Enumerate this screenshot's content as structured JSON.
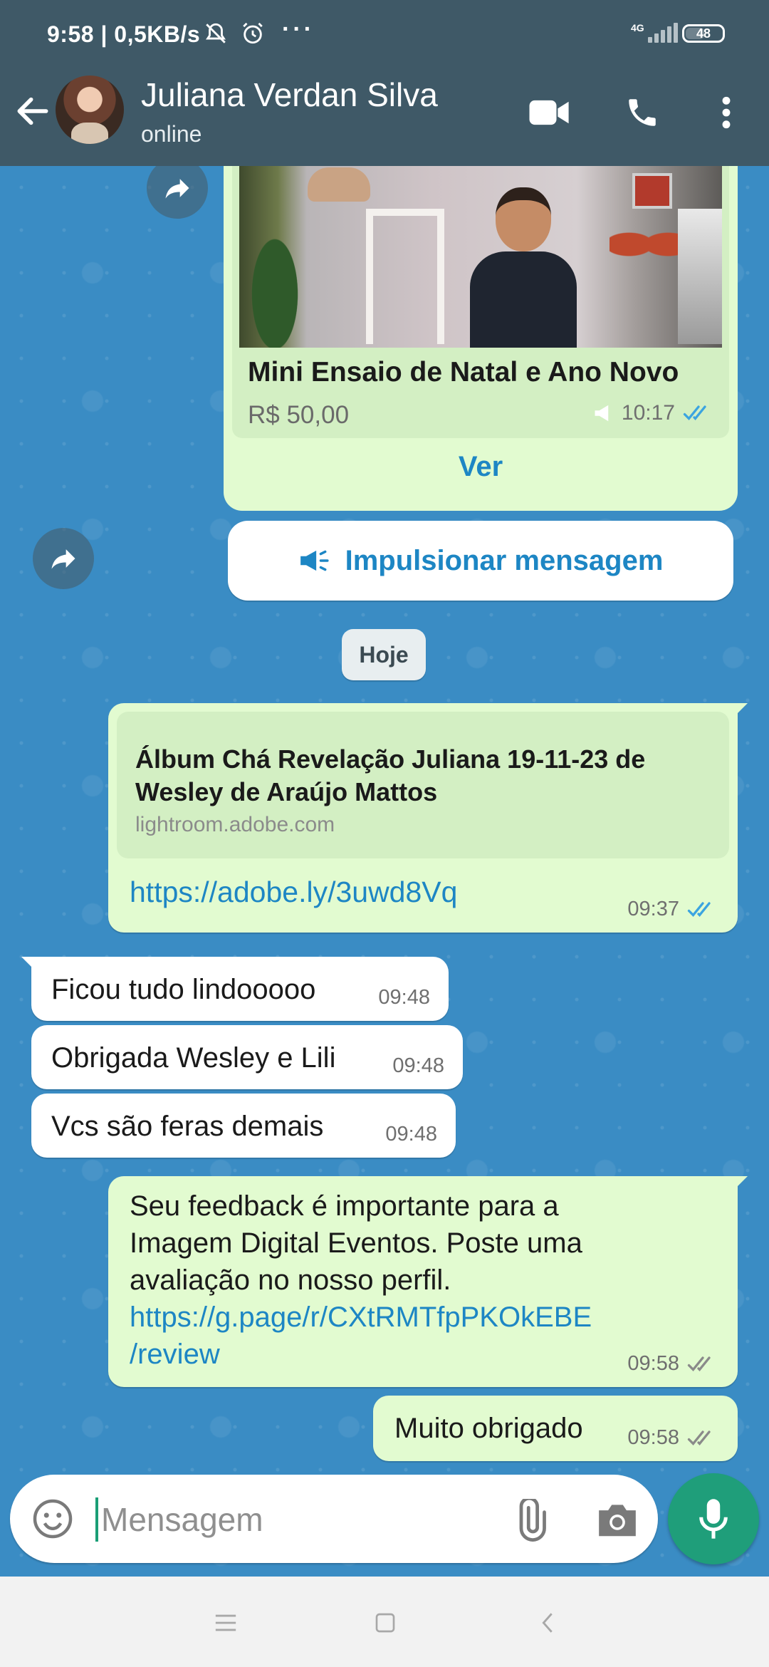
{
  "status_bar": {
    "time": "9:58",
    "speed": "| 0,5KB/s",
    "network": "4G",
    "battery": "48"
  },
  "header": {
    "name": "Juliana Verdan Silva",
    "status": "online"
  },
  "product": {
    "title": "Mini Ensaio de Natal e Ano Novo",
    "price": "R$ 50,00",
    "time": "10:17",
    "view_label": "Ver"
  },
  "boost_label": "Impulsionar mensagem",
  "date_chip": "Hoje",
  "link_message": {
    "preview_title": "Álbum Chá Revelação Juliana 19-11-23 de Wesley de Araújo Mattos",
    "preview_domain": "lightroom.adobe.com",
    "url": "https://adobe.ly/3uwd8Vq",
    "time": "09:37"
  },
  "incoming": [
    {
      "text": "Ficou tudo lindooooo",
      "time": "09:48"
    },
    {
      "text": "Obrigada Wesley e Lili",
      "time": "09:48"
    },
    {
      "text": "Vcs são feras demais",
      "time": "09:48"
    }
  ],
  "feedback_message": {
    "line1": "Seu feedback é importante para a",
    "line2": "Imagem Digital Eventos. Poste uma",
    "line3": "avaliação no nosso perfil.",
    "link_line1": "https://g.page/r/CXtRMTfpPKOkEBE",
    "link_line2": "/review",
    "time": "09:58"
  },
  "last_message": {
    "text": "Muito obrigado",
    "time": "09:58"
  },
  "input": {
    "placeholder": "Mensagem"
  },
  "colors": {
    "header": "#3f5967",
    "chat_bg": "#3a8cc4",
    "outgoing": "#e2fbd0",
    "incoming": "#ffffff",
    "link": "#1d86c4",
    "accent": "#1f9e7a"
  }
}
